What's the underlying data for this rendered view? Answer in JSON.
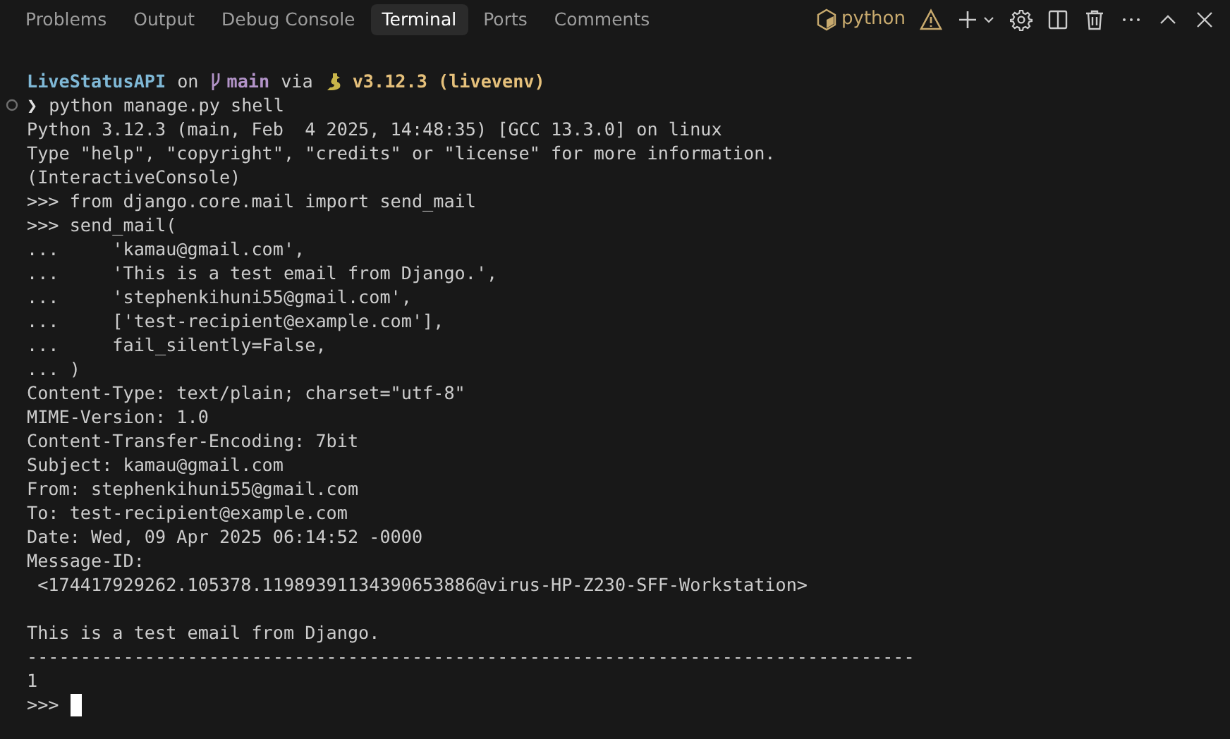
{
  "tabs": [
    {
      "label": "Problems",
      "selected": false
    },
    {
      "label": "Output",
      "selected": false
    },
    {
      "label": "Debug Console",
      "selected": false
    },
    {
      "label": "Terminal",
      "selected": true
    },
    {
      "label": "Ports",
      "selected": false
    },
    {
      "label": "Comments",
      "selected": false
    }
  ],
  "toolbar": {
    "shell_label": "python"
  },
  "terminal": {
    "prompt": [
      {
        "kind": "dir",
        "text": "LiveStatusAPI"
      },
      {
        "kind": "plain",
        "text": "on"
      },
      {
        "kind": "branch",
        "text": "main"
      },
      {
        "kind": "plain",
        "text": "via"
      },
      {
        "kind": "python",
        "text": "v3.12.3 (livevenv)"
      }
    ],
    "command": {
      "chevron": "❯",
      "text": "python manage.py shell"
    },
    "blocks": [
      [
        "Python 3.12.3 (main, Feb  4 2025, 14:48:35) [GCC 13.3.0] on linux",
        "Type \"help\", \"copyright\", \"credits\" or \"license\" for more information.",
        "(InteractiveConsole)",
        ">>> from django.core.mail import send_mail",
        ">>> send_mail(",
        "...     'kamau@gmail.com',",
        "...     'This is a test email from Django.',",
        "...     'stephenkihuni55@gmail.com',",
        "...     ['test-recipient@example.com'],",
        "...     fail_silently=False,",
        "... )",
        "Content-Type: text/plain; charset=\"utf-8\"",
        "MIME-Version: 1.0",
        "Content-Transfer-Encoding: 7bit",
        "Subject: kamau@gmail.com",
        "From: stephenkihuni55@gmail.com",
        "To: test-recipient@example.com",
        "Date: Wed, 09 Apr 2025 06:14:52 -0000",
        "Message-ID:",
        " <174417929262.105378.11989391134390653886@virus-HP-Z230-SFF-Workstation>"
      ],
      [
        "This is a test email from Django.",
        "-----------------------------------------------------------------------------------",
        "1"
      ]
    ],
    "input_prompt": ">>>"
  }
}
